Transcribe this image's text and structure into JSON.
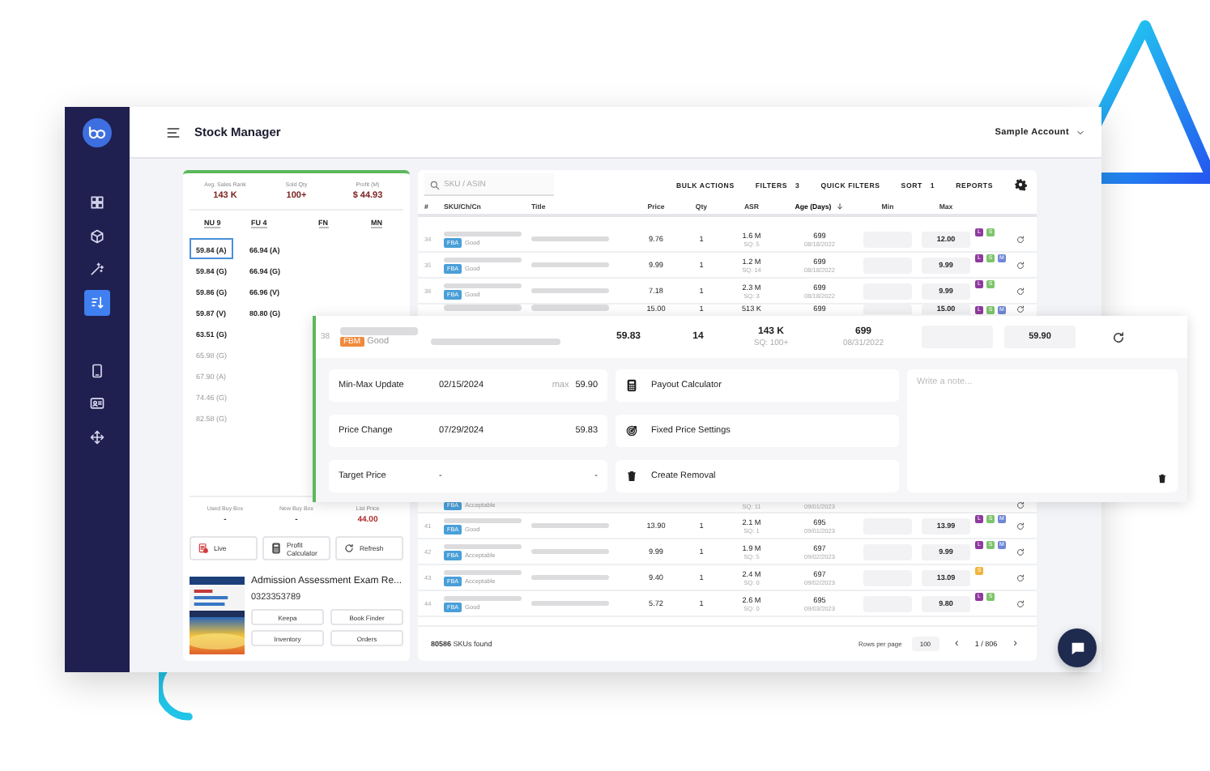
{
  "sidebar": {
    "sections": [
      {
        "items": [
          {
            "kind": "grid",
            "selected": false
          },
          {
            "kind": "cube",
            "selected": false
          },
          {
            "kind": "wand",
            "selected": false
          },
          {
            "kind": "sort",
            "selected": true
          }
        ]
      },
      {
        "items": [
          {
            "kind": "phone",
            "selected": false
          },
          {
            "kind": "card",
            "selected": false
          },
          {
            "kind": "move",
            "selected": false
          }
        ]
      }
    ]
  },
  "header": {
    "title": "Stock Manager",
    "account": "Sample Account"
  },
  "product_panel": {
    "stats": [
      {
        "label": "Avg. Sales Rank",
        "value": "143 K"
      },
      {
        "label": "Sold Qty",
        "value": "100+"
      },
      {
        "label": "Profit (M)",
        "value": "$ 44.93"
      }
    ],
    "offer_columns": [
      {
        "heading": "NU 9",
        "offers": [
          {
            "price": "59.84 (A)",
            "selected": true,
            "dimmed": false
          },
          {
            "price": "59.84 (G)",
            "selected": false,
            "dimmed": false
          },
          {
            "price": "59.86 (G)",
            "selected": false,
            "dimmed": false
          },
          {
            "price": "59.87 (V)",
            "selected": false,
            "dimmed": false
          },
          {
            "price": "63.51 (G)",
            "selected": false,
            "dimmed": false
          },
          {
            "price": "65.98 (G)",
            "selected": false,
            "dimmed": true
          },
          {
            "price": "67.90 (A)",
            "selected": false,
            "dimmed": true
          },
          {
            "price": "74.46 (G)",
            "selected": false,
            "dimmed": true
          },
          {
            "price": "82.58 (G)",
            "selected": false,
            "dimmed": true
          }
        ]
      },
      {
        "heading": "FU 4",
        "offers": [
          {
            "price": "66.94 (A)",
            "selected": false,
            "dimmed": false
          },
          {
            "price": "66.94 (G)",
            "selected": false,
            "dimmed": false
          },
          {
            "price": "66.96 (V)",
            "selected": false,
            "dimmed": false
          },
          {
            "price": "80.80 (G)",
            "selected": false,
            "dimmed": false
          }
        ]
      },
      {
        "heading": "FN"
      },
      {
        "heading": "MN"
      }
    ],
    "buy_box": [
      {
        "label": "Used Buy Box",
        "value": "-",
        "highlight": false
      },
      {
        "label": "New Buy Box",
        "value": "-",
        "highlight": false
      },
      {
        "label": "List Price",
        "value": "44.00",
        "highlight": true
      }
    ],
    "actions": [
      {
        "kind": "live",
        "label": "Live"
      },
      {
        "kind": "calculator",
        "label": "Profit Calculator"
      },
      {
        "kind": "refresh",
        "label": "Refresh"
      }
    ],
    "product": {
      "title": "Admission Assessment Exam Re...",
      "isbn": "0323353789",
      "links": [
        "Keepa",
        "Book Finder",
        "Inventory",
        "Orders"
      ]
    }
  },
  "table": {
    "search": {
      "placeholder": "SKU / ASIN"
    },
    "toolbar": [
      {
        "label": "BULK ACTIONS"
      },
      {
        "label": "FILTERS",
        "count": "3"
      },
      {
        "label": "QUICK FILTERS"
      },
      {
        "label": "SORT",
        "count": "1"
      },
      {
        "label": "REPORTS"
      }
    ],
    "columns": [
      {
        "label": "#",
        "sorted": false
      },
      {
        "label": "SKU/Ch/Cn",
        "sorted": false
      },
      {
        "label": "Title",
        "sorted": false
      },
      {
        "label": "Price",
        "sorted": false
      },
      {
        "label": "Qty",
        "sorted": false
      },
      {
        "label": "ASR",
        "sorted": false
      },
      {
        "label": "Age (Days)",
        "sorted": true
      },
      {
        "label": "Min",
        "sorted": false
      },
      {
        "label": "Max",
        "sorted": false
      }
    ],
    "rows": [
      {
        "kind": "full",
        "num": "34",
        "channel": {
          "label": "FBA",
          "color": "#4a9fd8"
        },
        "condition": "Good",
        "price": "9.76",
        "qty": "1",
        "asr": "1.6 M",
        "sq": "SQ: 5",
        "age": "699",
        "date": "08/18/2022",
        "max": "12.00",
        "tags": [
          {
            "letter": "L",
            "color": "#8e3a9d"
          },
          {
            "letter": "S",
            "color": "#7cc46b"
          }
        ]
      },
      {
        "kind": "full",
        "num": "35",
        "channel": {
          "label": "FBA",
          "color": "#4a9fd8"
        },
        "condition": "Good",
        "price": "9.99",
        "qty": "1",
        "asr": "1.2 M",
        "sq": "SQ: 14",
        "age": "699",
        "date": "08/18/2022",
        "max": "9.99",
        "tags": [
          {
            "letter": "L",
            "color": "#8e3a9d"
          },
          {
            "letter": "S",
            "color": "#7cc46b"
          },
          {
            "letter": "M",
            "color": "#6f86d6"
          }
        ]
      },
      {
        "kind": "full",
        "num": "36",
        "channel": {
          "label": "FBA",
          "color": "#4a9fd8"
        },
        "condition": "Good",
        "price": "7.18",
        "qty": "1",
        "asr": "2.3 M",
        "sq": "SQ: 3",
        "age": "699",
        "date": "08/18/2022",
        "max": "9.99",
        "tags": [
          {
            "letter": "L",
            "color": "#8e3a9d"
          },
          {
            "letter": "S",
            "color": "#7cc46b"
          }
        ]
      },
      {
        "kind": "top",
        "price": "15.00",
        "qty": "1",
        "asr": "513 K",
        "age": "699",
        "max": "15.00",
        "tags": [
          {
            "letter": "L",
            "color": "#8e3a9d"
          },
          {
            "letter": "S",
            "color": "#7cc46b"
          },
          {
            "letter": "M",
            "color": "#6f86d6"
          }
        ]
      },
      {
        "kind": "bottom",
        "channel": {
          "label": "FBA",
          "color": "#4a9fd8"
        },
        "condition": "Acceptable",
        "sq": "SQ: 11",
        "date": "09/01/2023"
      },
      {
        "kind": "full",
        "num": "41",
        "channel": {
          "label": "FBA",
          "color": "#4a9fd8"
        },
        "condition": "Good",
        "price": "13.90",
        "qty": "1",
        "asr": "2.1 M",
        "sq": "SQ: 1",
        "age": "695",
        "date": "09/01/2023",
        "max": "13.99",
        "tags": [
          {
            "letter": "L",
            "color": "#8e3a9d"
          },
          {
            "letter": "S",
            "color": "#7cc46b"
          },
          {
            "letter": "M",
            "color": "#6f86d6"
          }
        ]
      },
      {
        "kind": "full",
        "num": "42",
        "channel": {
          "label": "FBA",
          "color": "#4a9fd8"
        },
        "condition": "Acceptable",
        "price": "9.99",
        "qty": "1",
        "asr": "1.9 M",
        "sq": "SQ: 5",
        "age": "697",
        "date": "09/02/2023",
        "max": "9.99",
        "tags": [
          {
            "letter": "L",
            "color": "#8e3a9d"
          },
          {
            "letter": "S",
            "color": "#7cc46b"
          },
          {
            "letter": "M",
            "color": "#6f86d6"
          }
        ]
      },
      {
        "kind": "full",
        "num": "43",
        "channel": {
          "label": "FBA",
          "color": "#4a9fd8"
        },
        "condition": "Acceptable",
        "price": "9.40",
        "qty": "1",
        "asr": "2.4 M",
        "sq": "SQ: 0",
        "age": "697",
        "date": "09/02/2023",
        "max": "13.09",
        "tags": [
          {
            "letter": "S",
            "color": "#f0b43c"
          }
        ]
      },
      {
        "kind": "full",
        "num": "44",
        "channel": {
          "label": "FBA",
          "color": "#4a9fd8"
        },
        "condition": "Good",
        "price": "5.72",
        "qty": "1",
        "asr": "2.6 M",
        "sq": "SQ: 0",
        "age": "695",
        "date": "09/03/2023",
        "max": "9.80",
        "tags": [
          {
            "letter": "L",
            "color": "#8e3a9d"
          },
          {
            "letter": "S",
            "color": "#7cc46b"
          }
        ]
      }
    ],
    "footer": {
      "summary": "**80586** SKUs found",
      "rows_label": "Rows per page",
      "rows_value": "100",
      "prev": "‹",
      "page": "1 / 806",
      "next": "›"
    }
  },
  "expanded_row": {
    "num": "38",
    "channel": {
      "label": "FBM",
      "color": "#f08a3c"
    },
    "condition": "Good",
    "price": "59.83",
    "qty": "14",
    "asr": "143 K",
    "sq": "SQ: 100+",
    "age": "699",
    "date": "08/31/2022",
    "max": "59.90",
    "details": [
      {
        "label": "Min-Max Update",
        "date": "02/15/2024",
        "note": "max",
        "value": "59.90"
      },
      {
        "label": "Price Change",
        "date": "07/29/2024",
        "value": "59.83"
      },
      {
        "label": "Target Price",
        "date": "-",
        "value": "-"
      }
    ],
    "tools": [
      {
        "kind": "calculator",
        "label": "Payout Calculator"
      },
      {
        "kind": "target",
        "label": "Fixed Price Settings"
      },
      {
        "kind": "trash",
        "label": "Create Removal"
      }
    ],
    "note": {
      "placeholder": "Write a note..."
    }
  }
}
